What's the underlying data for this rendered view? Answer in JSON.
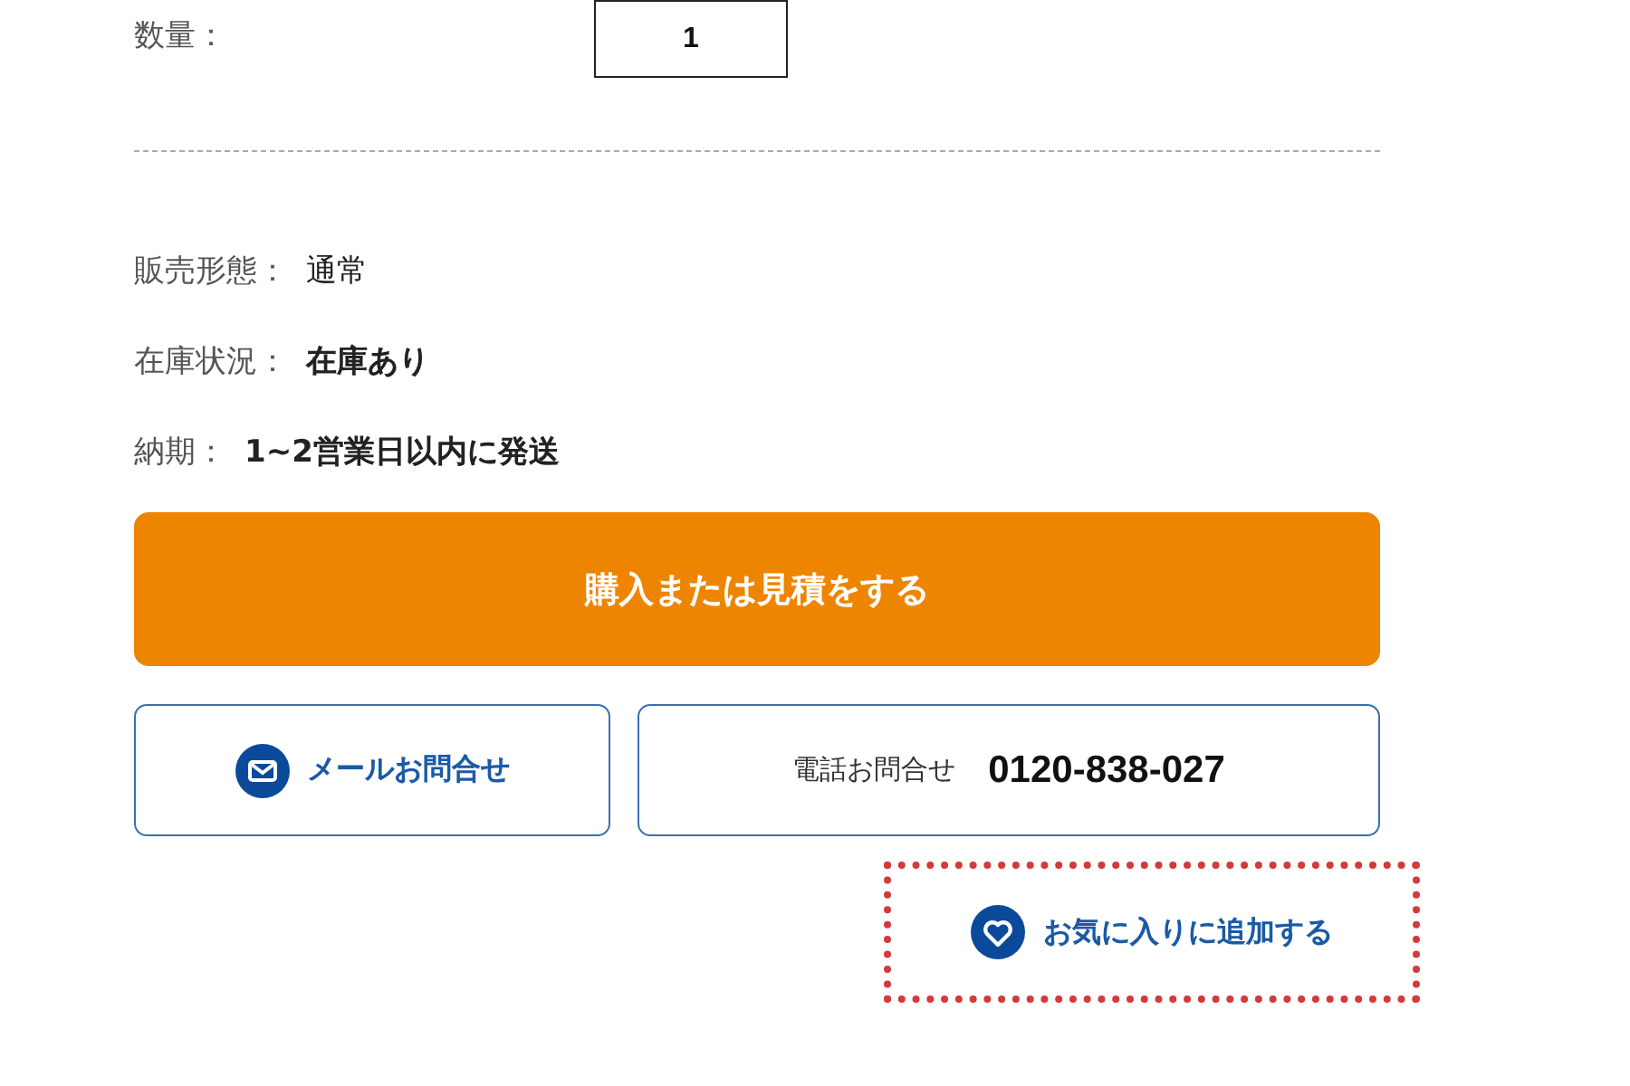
{
  "quantity": {
    "label": "数量：",
    "value": "1"
  },
  "details": [
    {
      "label": "販売形態：",
      "value": "通常",
      "emphasis": false
    },
    {
      "label": "在庫状況：",
      "value": "在庫あり",
      "emphasis": true
    },
    {
      "label": "納期：",
      "value": "1~2営業日以内に発送",
      "emphasis": true
    }
  ],
  "purchase_button": "購入または見積をする",
  "mail_button": "メールお問合せ",
  "phone": {
    "label": "電話お問合せ",
    "number": "0120-838-027"
  },
  "favorite_link": "お気に入りに追加する"
}
